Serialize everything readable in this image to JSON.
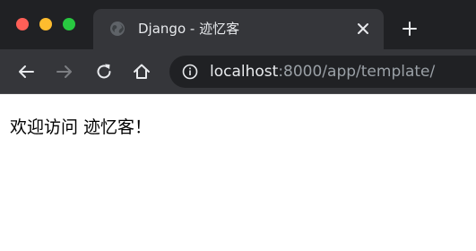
{
  "window": {
    "colors": {
      "close": "#ff5f57",
      "minimize": "#febc2e",
      "maximize": "#28c840"
    }
  },
  "tab": {
    "title": "Django - 迹忆客",
    "favicon": "globe-icon"
  },
  "toolbar": {
    "icons": [
      "back-arrow-icon",
      "forward-arrow-icon",
      "reload-icon",
      "home-icon",
      "info-icon"
    ]
  },
  "address_bar": {
    "host": "localhost",
    "rest": ":8000/app/template/"
  },
  "page": {
    "body_text": "欢迎访问 迹忆客！"
  }
}
